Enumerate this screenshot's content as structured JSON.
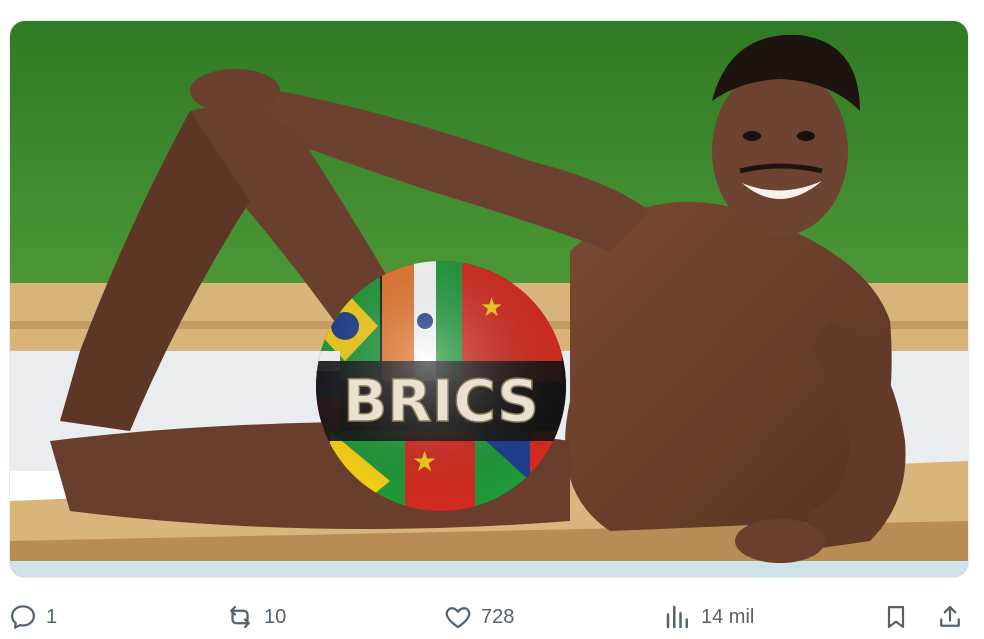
{
  "media": {
    "badge_text": "BRICS",
    "alt_description_icon": "photo-icon"
  },
  "actions": {
    "reply": {
      "icon": "reply-icon",
      "count": "1"
    },
    "repost": {
      "icon": "repost-icon",
      "count": "10"
    },
    "like": {
      "icon": "heart-icon",
      "count": "728"
    },
    "views": {
      "icon": "views-icon",
      "count": "14 mil"
    },
    "bookmark": {
      "icon": "bookmark-icon"
    },
    "share": {
      "icon": "share-icon"
    }
  },
  "colors": {
    "action_gray": "#536471",
    "grass": "#3f8a2e",
    "pool_tile": "#d9b77f"
  }
}
